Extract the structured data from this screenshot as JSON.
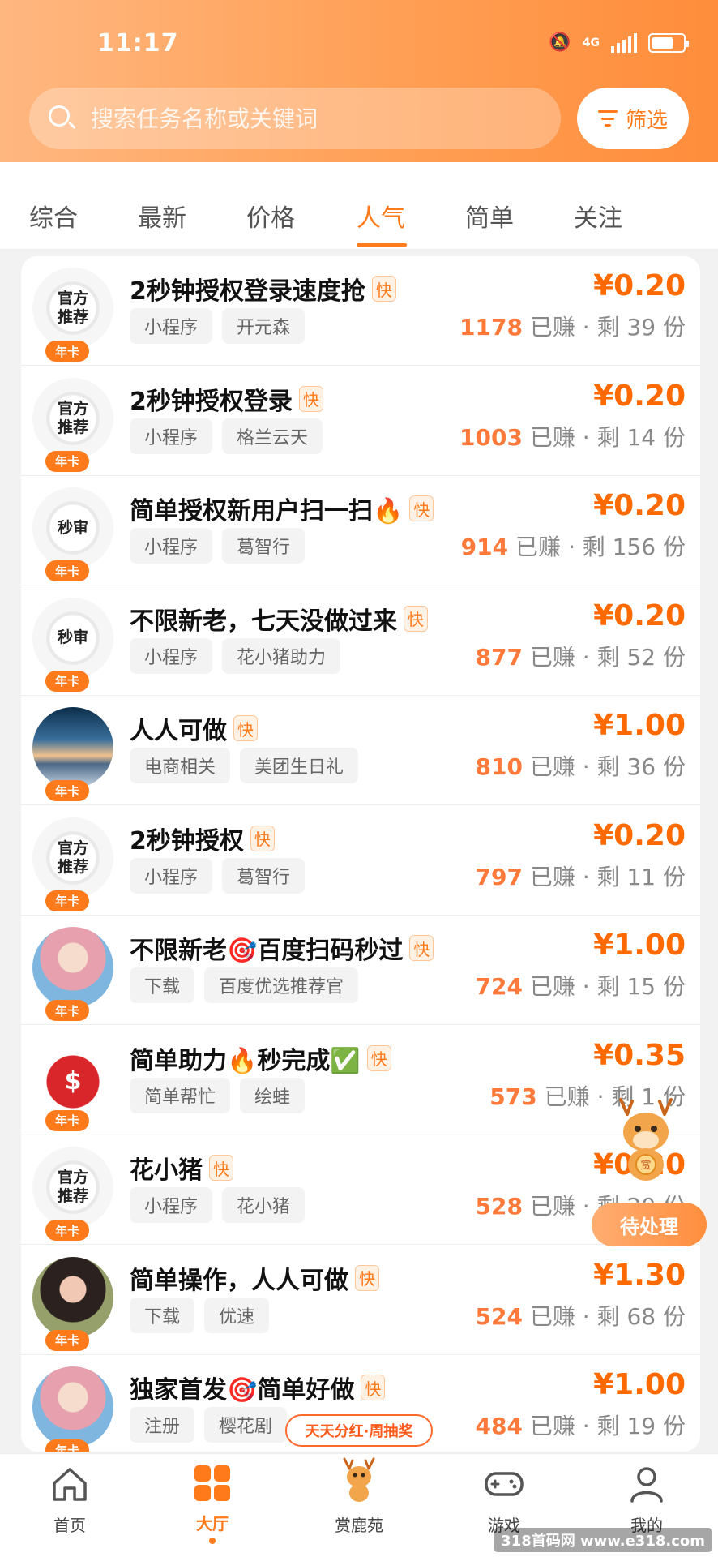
{
  "status_bar": {
    "time": "11:17",
    "network": "4G"
  },
  "search": {
    "placeholder": "搜索任务名称或关键词"
  },
  "filter": {
    "label": "筛选"
  },
  "tabs": [
    {
      "label": "综合",
      "active": false
    },
    {
      "label": "最新",
      "active": false
    },
    {
      "label": "价格",
      "active": false
    },
    {
      "label": "人气",
      "active": true
    },
    {
      "label": "简单",
      "active": false
    },
    {
      "label": "关注",
      "active": false
    }
  ],
  "badge_label": "年卡",
  "fast_label": "快",
  "earned_suffix": "已赚",
  "tasks": [
    {
      "title": "2秒钟授权登录速度抢",
      "avatar": "官方推荐",
      "avatar_type": "official",
      "tags": [
        "小程序",
        "开元森"
      ],
      "price": "¥0.20",
      "earned": "1178",
      "remaining": "剩 39 份"
    },
    {
      "title": "2秒钟授权登录",
      "avatar": "官方推荐",
      "avatar_type": "official",
      "tags": [
        "小程序",
        "格兰云天"
      ],
      "price": "¥0.20",
      "earned": "1003",
      "remaining": "剩 14 份"
    },
    {
      "title": "简单授权新用户扫一扫🔥",
      "avatar": "秒审",
      "avatar_type": "official",
      "tags": [
        "小程序",
        "葛智行"
      ],
      "price": "¥0.20",
      "earned": "914",
      "remaining": "剩 156 份"
    },
    {
      "title": "不限新老，七天没做过来",
      "avatar": "秒审",
      "avatar_type": "official",
      "tags": [
        "小程序",
        "花小猪助力"
      ],
      "price": "¥0.20",
      "earned": "877",
      "remaining": "剩 52 份"
    },
    {
      "title": "人人可做",
      "avatar": "",
      "avatar_type": "photo-sky",
      "tags": [
        "电商相关",
        "美团生日礼"
      ],
      "price": "¥1.00",
      "earned": "810",
      "remaining": "剩 36 份"
    },
    {
      "title": "2秒钟授权",
      "avatar": "官方推荐",
      "avatar_type": "official",
      "tags": [
        "小程序",
        "葛智行"
      ],
      "price": "¥0.20",
      "earned": "797",
      "remaining": "剩 11 份"
    },
    {
      "title": "不限新老🎯百度扫码秒过",
      "avatar": "",
      "avatar_type": "girl-pink",
      "tags": [
        "下载",
        "百度优选推荐官"
      ],
      "price": "¥1.00",
      "earned": "724",
      "remaining": "剩 15 份"
    },
    {
      "title": "简单助力🔥秒完成✅",
      "avatar": "$",
      "avatar_type": "money",
      "tags": [
        "简单帮忙",
        "绘蛙"
      ],
      "price": "¥0.35",
      "earned": "573",
      "remaining": "剩 1 份"
    },
    {
      "title": "花小猪",
      "avatar": "官方推荐",
      "avatar_type": "official",
      "tags": [
        "小程序",
        "花小猪"
      ],
      "price": "¥0.20",
      "earned": "528",
      "remaining": "剩 20 份"
    },
    {
      "title": "简单操作，人人可做",
      "avatar": "",
      "avatar_type": "girl-dark",
      "tags": [
        "下载",
        "优速"
      ],
      "price": "¥1.30",
      "earned": "524",
      "remaining": "剩 68 份"
    },
    {
      "title": "独家首发🎯简单好做",
      "avatar": "",
      "avatar_type": "girl-pink",
      "tags": [
        "注册",
        "樱花剧"
      ],
      "price": "¥1.00",
      "earned": "484",
      "remaining": "剩 19 份"
    }
  ],
  "floating": {
    "pending_label": "待处理",
    "promo_label": "天天分红·周抽奖",
    "mascot_label": "赏"
  },
  "bottom_nav": [
    {
      "label": "首页",
      "icon": "home-icon",
      "active": false
    },
    {
      "label": "大厅",
      "icon": "grid-icon",
      "active": true
    },
    {
      "label": "赏鹿苑",
      "icon": "deer-icon",
      "active": false
    },
    {
      "label": "游戏",
      "icon": "gamepad-icon",
      "active": false
    },
    {
      "label": "我的",
      "icon": "user-icon",
      "active": false
    }
  ],
  "watermark": "318首码网 www.e318.com",
  "colors": {
    "accent": "#ff7a1a",
    "price": "#ff6a00",
    "header_start": "#ffb780",
    "header_end": "#ff8d3b"
  }
}
